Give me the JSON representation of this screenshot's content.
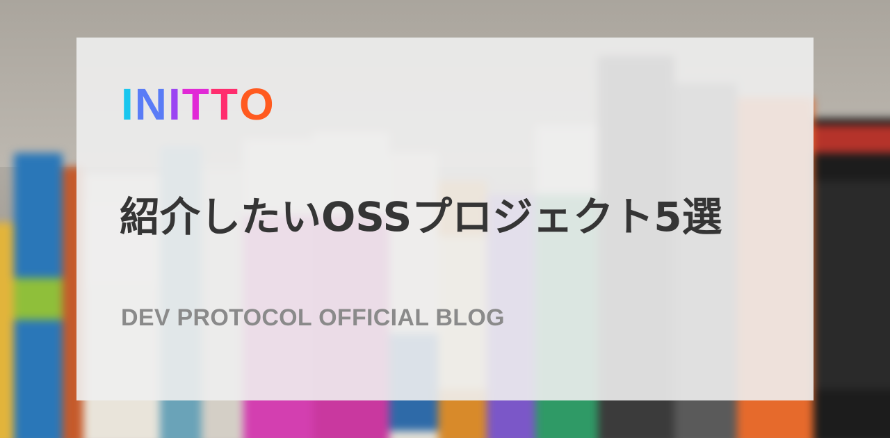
{
  "background": {
    "palette": [
      "#2a6fb0",
      "#e8e0d2",
      "#c93aa9",
      "#7d55c7",
      "#2f9e6a",
      "#3a3a3a",
      "#e46a2b",
      "#1d1d1d",
      "#d9c2a0",
      "#f2efe8"
    ]
  },
  "brand": {
    "letters": [
      "I",
      "N",
      "I",
      "T",
      "T",
      "O"
    ],
    "colors": [
      "#19c6ee",
      "#5a7cf6",
      "#9b45f2",
      "#e129d6",
      "#ff2d6e",
      "#ff5a1f"
    ]
  },
  "title": "紹介したいOSSプロジェクト5選",
  "subtitle": "DEV PROTOCOL OFFICIAL BLOG"
}
